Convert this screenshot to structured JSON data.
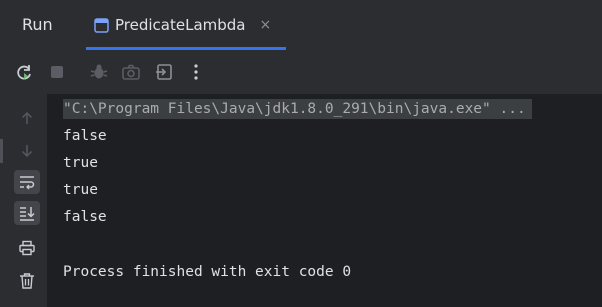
{
  "titlebar": {
    "run_label": "Run",
    "tab_label": "PredicateLambda",
    "tab_close": "×"
  },
  "toolbar": {
    "icons": [
      "rerun-icon",
      "stop-icon",
      "debug-icon",
      "screenshot-icon",
      "exit-icon",
      "more-icon"
    ]
  },
  "left_panel": {
    "icons": [
      "arrow-up-icon",
      "arrow-down-icon",
      "soft-wrap-icon",
      "scroll-to-end-icon",
      "print-icon",
      "trash-icon"
    ]
  },
  "console": {
    "command": "\"C:\\Program Files\\Java\\jdk1.8.0_291\\bin\\java.exe\" ...",
    "output": [
      "false",
      "true",
      "true",
      "false"
    ],
    "exit_message": "Process finished with exit code 0"
  }
}
